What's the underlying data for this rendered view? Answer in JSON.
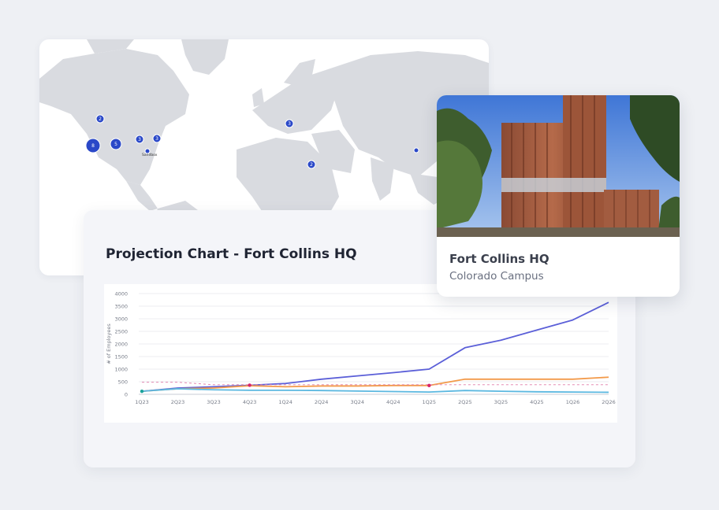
{
  "map": {
    "markers": [
      {
        "count": "2",
        "size": "small"
      },
      {
        "count": "8",
        "size": "large"
      },
      {
        "count": "5",
        "size": "medium"
      },
      {
        "count": "3",
        "size": "small"
      },
      {
        "count": "3",
        "size": "small"
      },
      {
        "count": "",
        "size": "dot"
      },
      {
        "count": "3",
        "size": "small"
      },
      {
        "count": "2",
        "size": "small"
      },
      {
        "count": "",
        "size": "dot"
      }
    ],
    "city_label": "Sandbox"
  },
  "chart": {
    "title": "Projection Chart - Fort Collins HQ"
  },
  "location": {
    "name": "Fort Collins HQ",
    "subtitle": "Colorado Campus"
  },
  "colors": {
    "marker": "#2a48c8",
    "series_blue": "#5b5fd8",
    "series_orange": "#f39a4a",
    "series_teal": "#5bb8e0"
  },
  "chart_data": {
    "type": "line",
    "categories": [
      "1Q23",
      "2Q23",
      "3Q23",
      "4Q23",
      "1Q24",
      "2Q24",
      "3Q24",
      "4Q24",
      "1Q25",
      "2Q25",
      "3Q25",
      "4Q25",
      "1Q26",
      "2Q26"
    ],
    "ylabel": "# of Employees",
    "ylim": [
      0,
      4000
    ],
    "yticks": [
      0,
      500,
      1000,
      1500,
      2000,
      2500,
      3000,
      3500,
      4000
    ],
    "series": [
      {
        "color": "#5b5fd8",
        "values": [
          120,
          250,
          300,
          360,
          430,
          600,
          730,
          860,
          1000,
          1850,
          2150,
          2550,
          2950,
          3650
        ]
      },
      {
        "color": "#f39a4a",
        "values": [
          120,
          220,
          250,
          340,
          300,
          330,
          330,
          350,
          350,
          600,
          600,
          600,
          600,
          680
        ]
      },
      {
        "color": "#5bb8e0",
        "values": [
          120,
          220,
          180,
          160,
          160,
          150,
          130,
          110,
          90,
          150,
          120,
          100,
          90,
          80
        ]
      },
      {
        "color": "#e07aa8",
        "dashed": true,
        "values": [
          480,
          480,
          380,
          380,
          380,
          380,
          380,
          380,
          380,
          380,
          380,
          380,
          380,
          380
        ]
      }
    ],
    "grid": true,
    "legend": "none"
  }
}
